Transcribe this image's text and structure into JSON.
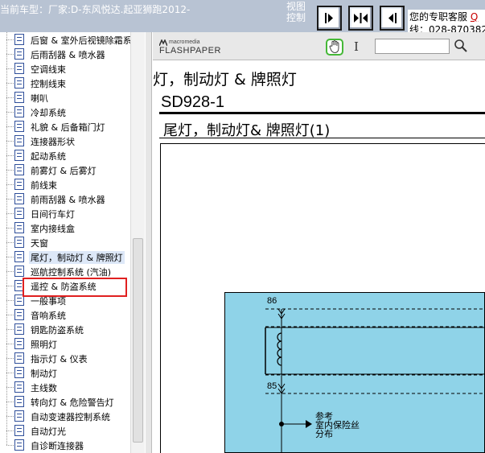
{
  "topbar": {
    "vehicle_label": "当前车型：厂家:D-东风悦达.起亚狮跑2012-",
    "view_label_line1": "视图",
    "view_label_line2": "控制",
    "buttons": [
      {
        "name": "show-left",
        "icon": "arrow-right-icon"
      },
      {
        "name": "split-view",
        "icon": "arrows-in-icon"
      },
      {
        "name": "show-right",
        "icon": "arrow-left-icon"
      }
    ],
    "service_label": "您的专职客服",
    "service_link": "Q",
    "service_phone": "线：028-870382"
  },
  "tree": {
    "items": [
      "后窗 & 室外后视镜除霜系",
      "后雨刮器 & 喷水器",
      "空调线束",
      "控制线束",
      "喇叭",
      "冷却系统",
      "礼貌 & 后备箱门灯",
      "连接器形状",
      "起动系统",
      "前雾灯 & 后雾灯",
      "前线束",
      "前雨刮器 & 喷水器",
      "日间行车灯",
      "室内接线盒",
      "天窗",
      "尾灯，制动灯 & 牌照灯",
      "巡航控制系统 (汽油)",
      "遥控 & 防盗系统",
      "一般事项",
      "音响系统",
      "钥匙防盗系统",
      "照明灯",
      "指示灯 & 仪表",
      "制动灯",
      "主线数",
      "转向灯 & 危险警告灯",
      "自动变速器控制系统",
      "自动灯光",
      "自诊断连接器"
    ],
    "selected_index": 15
  },
  "viewer": {
    "brand_small": "macromedia",
    "brand_large": "FLASHPAPER",
    "text_tool_glyph": "I",
    "search_value": "",
    "heading": "灯，制动灯 & 牌照灯",
    "code": "SD928-1",
    "subtitle": "尾灯，制动灯& 牌照灯(1)",
    "terminal_top": "86",
    "terminal_bottom": "85",
    "ref_note": [
      "参考",
      "室内保险丝",
      "分布"
    ]
  }
}
